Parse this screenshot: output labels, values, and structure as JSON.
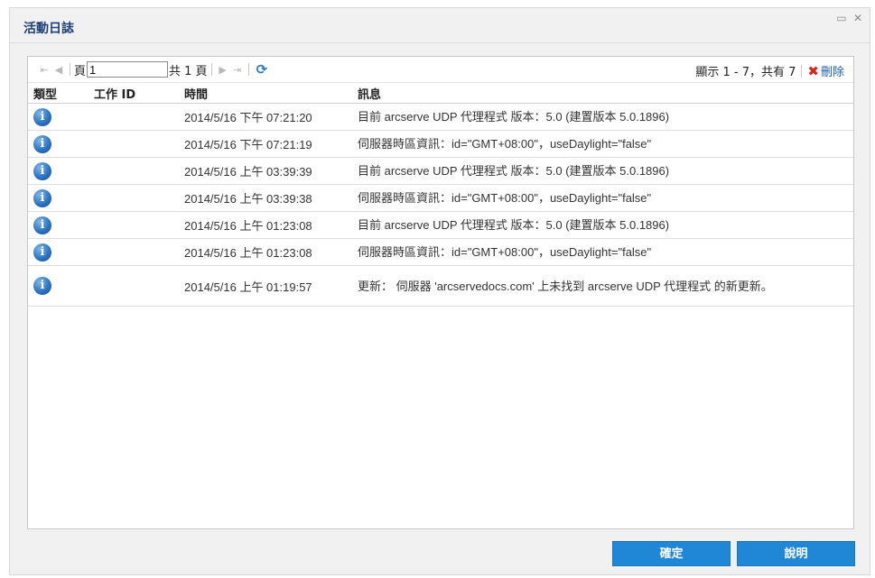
{
  "dialog": {
    "title": "活動日誌",
    "controls": {
      "restore": "▭",
      "close": "✕"
    }
  },
  "toolbar": {
    "first": "⇤",
    "prev": "◀",
    "page_label": "頁",
    "page_value": "1",
    "page_total": "共 1 頁",
    "next": "▶",
    "last": "⇥",
    "refresh": "⟳",
    "display_info": "顯示 1 - 7，共有 7",
    "delete_icon": "✖",
    "delete_label": "刪除"
  },
  "table": {
    "columns": [
      "類型",
      "工作 ID",
      "時間",
      "訊息"
    ],
    "rows": [
      {
        "type_icon": "info-icon",
        "job_id": "",
        "time": "2014/5/16 下午 07:21:20",
        "message": "目前 arcserve UDP 代理程式 版本：5.0 (建置版本 5.0.1896)"
      },
      {
        "type_icon": "info-icon",
        "job_id": "",
        "time": "2014/5/16 下午 07:21:19",
        "message": "伺服器時區資訊：id=\"GMT+08:00\"，useDaylight=\"false\""
      },
      {
        "type_icon": "info-icon",
        "job_id": "",
        "time": "2014/5/16 上午 03:39:39",
        "message": "目前 arcserve UDP 代理程式 版本：5.0 (建置版本 5.0.1896)"
      },
      {
        "type_icon": "info-icon",
        "job_id": "",
        "time": "2014/5/16 上午 03:39:38",
        "message": "伺服器時區資訊：id=\"GMT+08:00\"，useDaylight=\"false\""
      },
      {
        "type_icon": "info-icon",
        "job_id": "",
        "time": "2014/5/16 上午 01:23:08",
        "message": "目前 arcserve UDP 代理程式 版本：5.0 (建置版本 5.0.1896)"
      },
      {
        "type_icon": "info-icon",
        "job_id": "",
        "time": "2014/5/16 上午 01:23:08",
        "message": "伺服器時區資訊：id=\"GMT+08:00\"，useDaylight=\"false\""
      },
      {
        "type_icon": "info-icon",
        "job_id": "",
        "time": "2014/5/16 上午 01:19:57",
        "message": "更新： 伺服器 'arcservedocs.com' 上未找到 arcserve UDP 代理程式 的新更新。"
      }
    ]
  },
  "buttons": {
    "ok": "確定",
    "help": "說明"
  },
  "colors": {
    "accent": "#1f87d6",
    "title": "#1e3f78",
    "delete": "#d9251c"
  }
}
